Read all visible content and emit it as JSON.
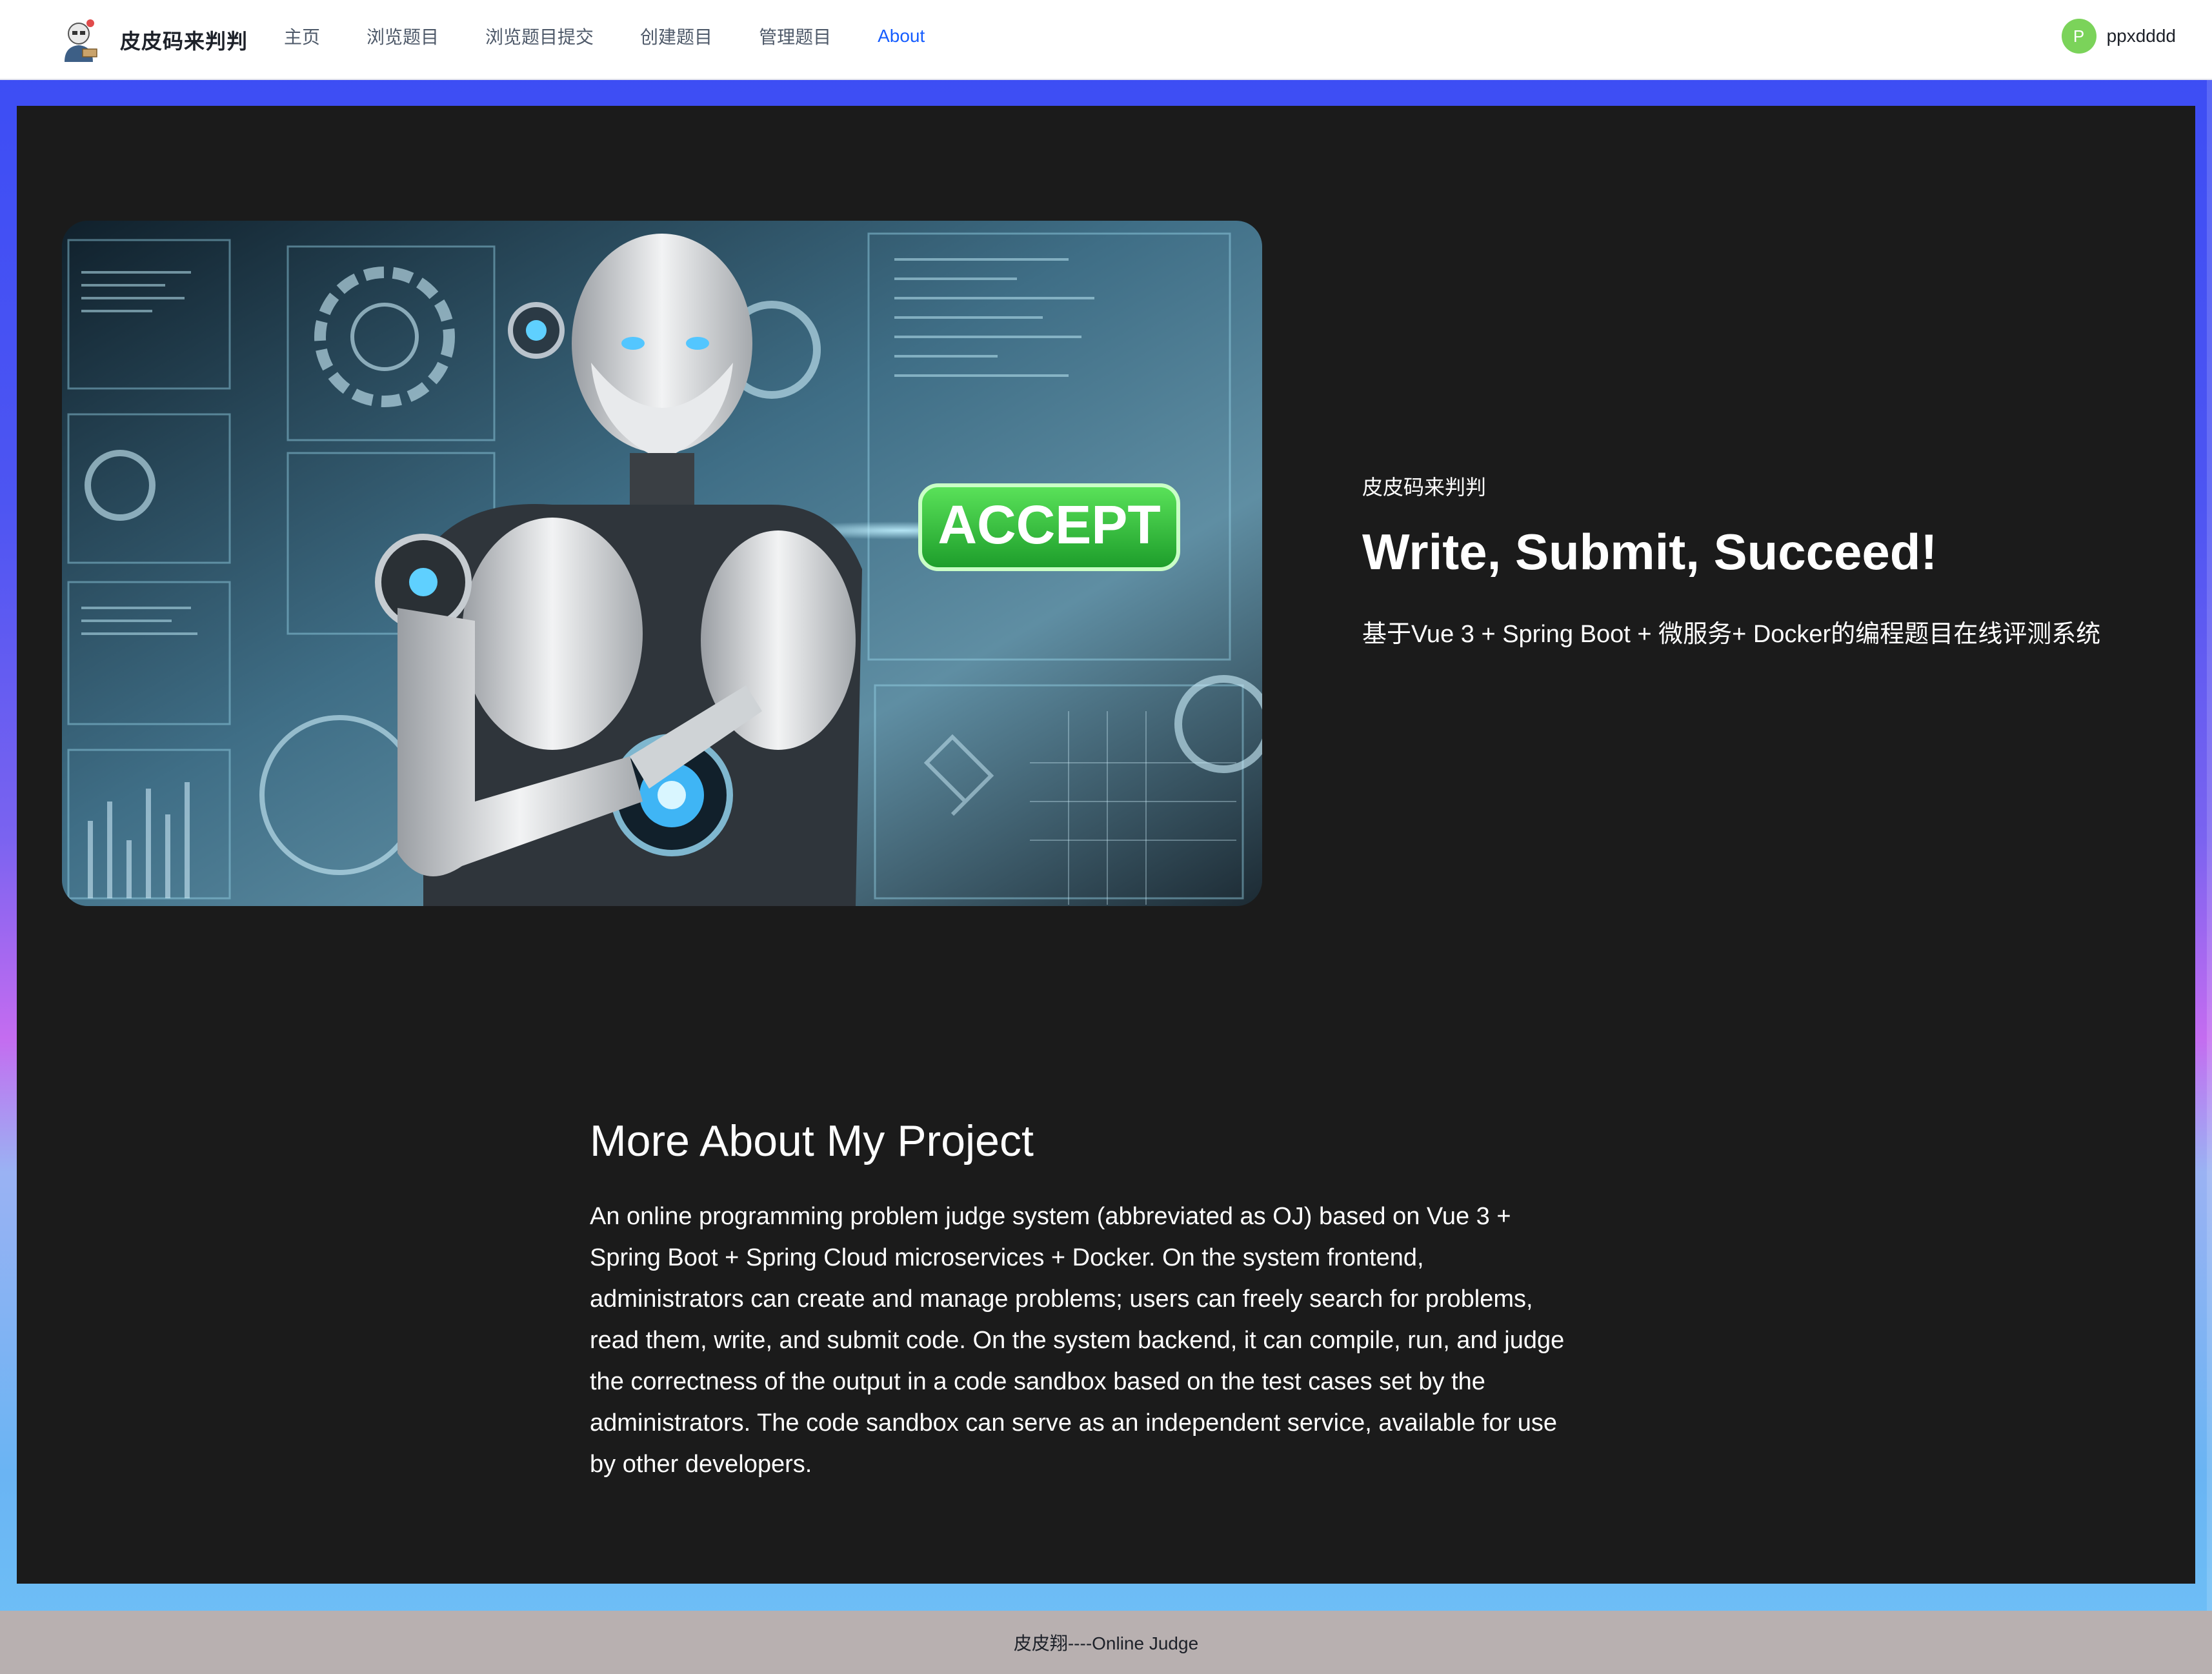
{
  "header": {
    "brand_title": "皮皮码来判判",
    "menu": [
      {
        "label": "主页",
        "active": false
      },
      {
        "label": "浏览题目",
        "active": false
      },
      {
        "label": "浏览题目提交",
        "active": false
      },
      {
        "label": "创建题目",
        "active": false
      },
      {
        "label": "管理题目",
        "active": false
      },
      {
        "label": "About",
        "active": true
      }
    ],
    "user": {
      "avatar_letter": "P",
      "name": "ppxdddd"
    }
  },
  "hero": {
    "image_text": "ACCEPT",
    "kicker": "皮皮码来判判",
    "title": "Write, Submit, Succeed!",
    "subtitle": "基于Vue 3 + Spring Boot + 微服务+ Docker的编程题目在线评测系统"
  },
  "about": {
    "title": "More About My Project",
    "body_lines": [
      "An online programming problem judge system (abbreviated as OJ) based on Vue 3 +",
      "Spring Boot + Spring Cloud microservices + Docker. On the system frontend,",
      "administrators can create and manage problems; users can freely search for problems,",
      "read them, write, and submit code. On the system backend, it can compile, run, and judge",
      "the correctness of the output in a code sandbox based on the test cases set by the",
      "administrators. The code sandbox can serve as an independent service, available for use",
      "by other developers."
    ]
  },
  "footer": {
    "text": "皮皮翔----Online Judge"
  },
  "colors": {
    "accent": "#165dff",
    "panel": "#1b1b1b",
    "avatar": "#7bd35a",
    "accept_green": "#22c23a"
  }
}
